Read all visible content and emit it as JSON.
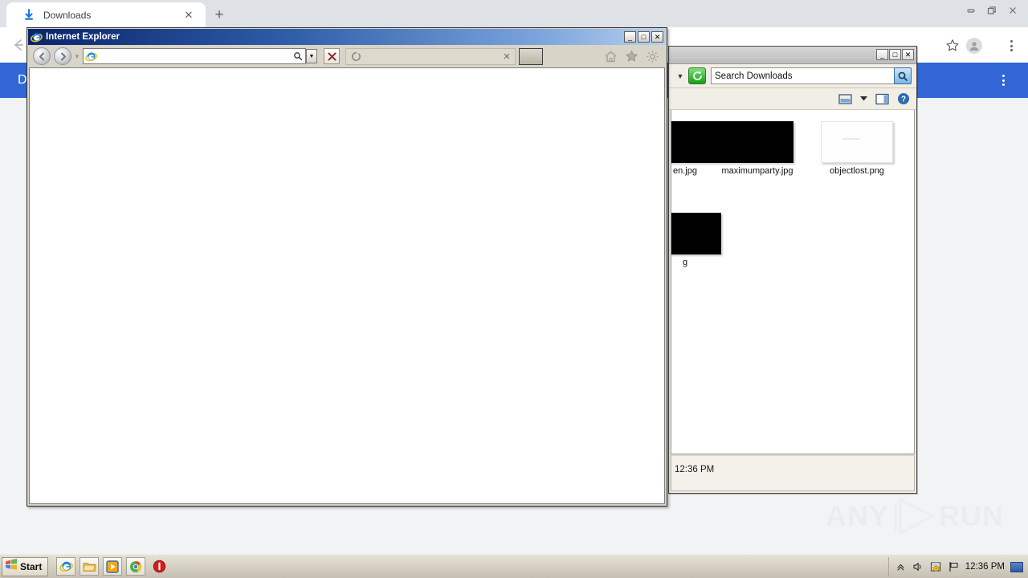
{
  "chrome": {
    "tab": {
      "title": "Downloads",
      "favicon_icon": "download-icon",
      "close_icon": "close-icon"
    },
    "new_tab_icon": "plus-icon",
    "window_controls": {
      "minimize": "—",
      "maximize": "❐",
      "close": "✕"
    },
    "back_icon": "back-arrow-icon",
    "bookmark_icon": "star-icon",
    "profile_icon": "avatar-icon",
    "menu_icon": "three-dot-menu-icon",
    "downloads_page": {
      "title": "Downloads",
      "menu_icon": "three-dot-menu-icon"
    }
  },
  "explorer": {
    "window_controls": {
      "minimize": "_",
      "maximize": "□",
      "close": "✕"
    },
    "history_dropdown_icon": "chevron-down-icon",
    "refresh_icon": "refresh-icon",
    "search": {
      "value": "Search Downloads",
      "placeholder": "Search Downloads"
    },
    "search_button_icon": "magnifier-icon",
    "toolbar": {
      "view_icon": "view-layout-icon",
      "view_dropdown_icon": "chevron-down-icon",
      "preview_pane_icon": "preview-pane-icon",
      "help_icon": "help-icon"
    },
    "files": [
      {
        "name": "en.jpg",
        "thumb": "black",
        "partial": true
      },
      {
        "name": "maximumparty.jpg",
        "thumb": "black",
        "partial": false
      },
      {
        "name": "objectlost.png",
        "thumb": "white",
        "partial": false
      },
      {
        "name": "g",
        "thumb": "black",
        "partial": true
      }
    ],
    "status_text": "12:36 PM"
  },
  "ie": {
    "title": "Internet Explorer",
    "logo_icon": "internet-explorer-icon",
    "window_controls": {
      "minimize": "_",
      "maximize": "□",
      "close": "✕"
    },
    "back_icon": "back-arrow-icon",
    "forward_icon": "forward-arrow-icon",
    "history_dropdown_icon": "chevron-down-icon",
    "address": {
      "value": "",
      "placeholder": ""
    },
    "address_icon": "internet-explorer-icon",
    "search_go_icon": "magnifier-icon",
    "address_dropdown_icon": "chevron-down-icon",
    "stop_icon": "stop-x-icon",
    "tab": {
      "label": "",
      "loading_icon": "loading-spinner-icon",
      "close_icon": "close-icon"
    },
    "new_tab_icon": "new-tab-icon",
    "icons": {
      "home": "home-icon",
      "favorites": "star-icon",
      "tools": "gear-icon"
    }
  },
  "watermark": {
    "left_text": "ANY",
    "right_text": "RUN",
    "play_icon": "play-triangle-icon"
  },
  "taskbar": {
    "start_label": "Start",
    "start_icon": "windows-flag-icon",
    "quicklaunch": [
      {
        "name": "internet-explorer",
        "icon": "internet-explorer-icon"
      },
      {
        "name": "file-explorer",
        "icon": "folder-icon"
      },
      {
        "name": "media-player",
        "icon": "media-player-icon"
      },
      {
        "name": "google-chrome",
        "icon": "chrome-icon"
      },
      {
        "name": "alert-app",
        "icon": "red-circle-icon"
      }
    ],
    "tray": {
      "expand_icon": "chevron-up-icon",
      "volume_icon": "speaker-icon",
      "security_icon": "security-shield-icon",
      "network_icon": "flag-icon",
      "clock": "12:36 PM",
      "show_desktop_icon": "show-desktop-icon"
    }
  },
  "colors": {
    "chrome_header_blue": "#3367d6",
    "chrome_tabstrip": "#dee1e6",
    "ie_title_blue": "#0a246a",
    "explorer_chrome": "#f1eee5",
    "taskbar": "#d4cfc2"
  }
}
